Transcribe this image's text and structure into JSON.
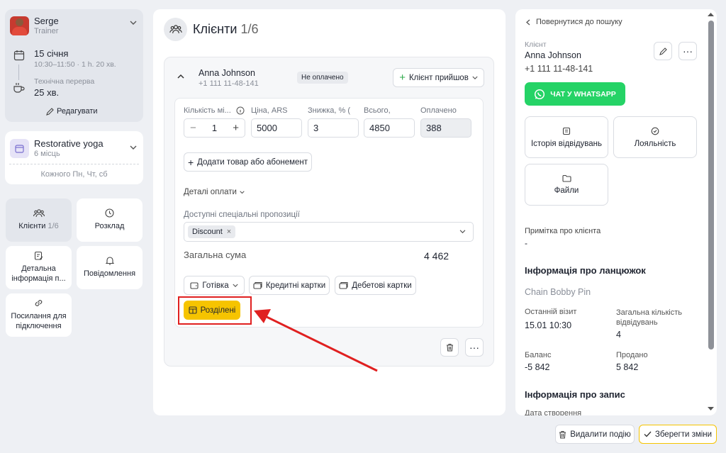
{
  "trainer": {
    "name": "Serge",
    "role": "Trainer"
  },
  "schedule": {
    "date": "15 січня",
    "time": "10:30–11:50 · 1 h. 20 хв.",
    "break_label": "Технічна перерва",
    "break_value": "25 хв.",
    "edit_label": "Редагувати"
  },
  "class_info": {
    "name": "Restorative yoga",
    "spots": "6 місць",
    "recurrence": "Кожного Пн, Чт, сб"
  },
  "nav": {
    "clients_label": "Клієнти",
    "clients_count": "1/6",
    "schedule_label": "Розклад",
    "details_label": "Детальна інформація п...",
    "notifications_label": "Повідомлення",
    "links_label": "Посилання для підключення"
  },
  "center": {
    "title": "Клієнти",
    "title_count": "1/6",
    "client_name": "Anna Johnson",
    "client_phone": "+1 111 11-48-141",
    "status_badge": "Не оплачено",
    "arrived_button": "Клієнт прийшов",
    "columns": {
      "qty": "Кількість мі...",
      "price": "Ціна, ARS",
      "discount": "Знижка, % (",
      "total": "Всього,",
      "paid": "Оплачено"
    },
    "values": {
      "qty": "1",
      "price": "5000",
      "discount": "3",
      "total": "4850",
      "paid": "388"
    },
    "add_product_button": "Додати товар або абонемент",
    "payment_details_toggle": "Деталі оплати",
    "offers_label": "Доступні спеціальні пропозиції",
    "offers_chip": "Discount",
    "total_sum_label": "Загальна сума",
    "total_sum_value": "4 462",
    "pay_cash": "Готівка",
    "pay_credit": "Кредитні картки",
    "pay_debit": "Дебетові картки",
    "pay_split": "Розділені"
  },
  "right": {
    "back_link": "Повернутися до пошуку",
    "client_label": "Клієнт",
    "client_name": "Anna Johnson",
    "client_phone": "+1 111 11-48-141",
    "whatsapp_button": "ЧАТ У WHATSAPP",
    "history_button": "Історія відвідувань",
    "loyalty_button": "Лояльність",
    "files_button": "Файли",
    "note_label": "Примітка про клієнта",
    "note_value": "-",
    "chain_title": "Інформація про ланцюжок",
    "chain_name": "Chain Bobby Pin",
    "last_visit_label": "Останній візит",
    "last_visit_value": "15.01 10:30",
    "visits_total_label": "Загальна кількість відвідувань",
    "visits_total_value": "4",
    "balance_label": "Баланс",
    "balance_value": "-5 842",
    "sold_label": "Продано",
    "sold_value": "5 842",
    "booking_title": "Інформація про запис",
    "created_label": "Дата створення"
  },
  "footer": {
    "delete_button": "Видалити подію",
    "save_button": "Зберегти зміни"
  },
  "colors": {
    "accent_yellow": "#f6c400",
    "whatsapp_green": "#25d366",
    "annotation_red": "#e02020",
    "plus_green": "#2eaa4a"
  }
}
